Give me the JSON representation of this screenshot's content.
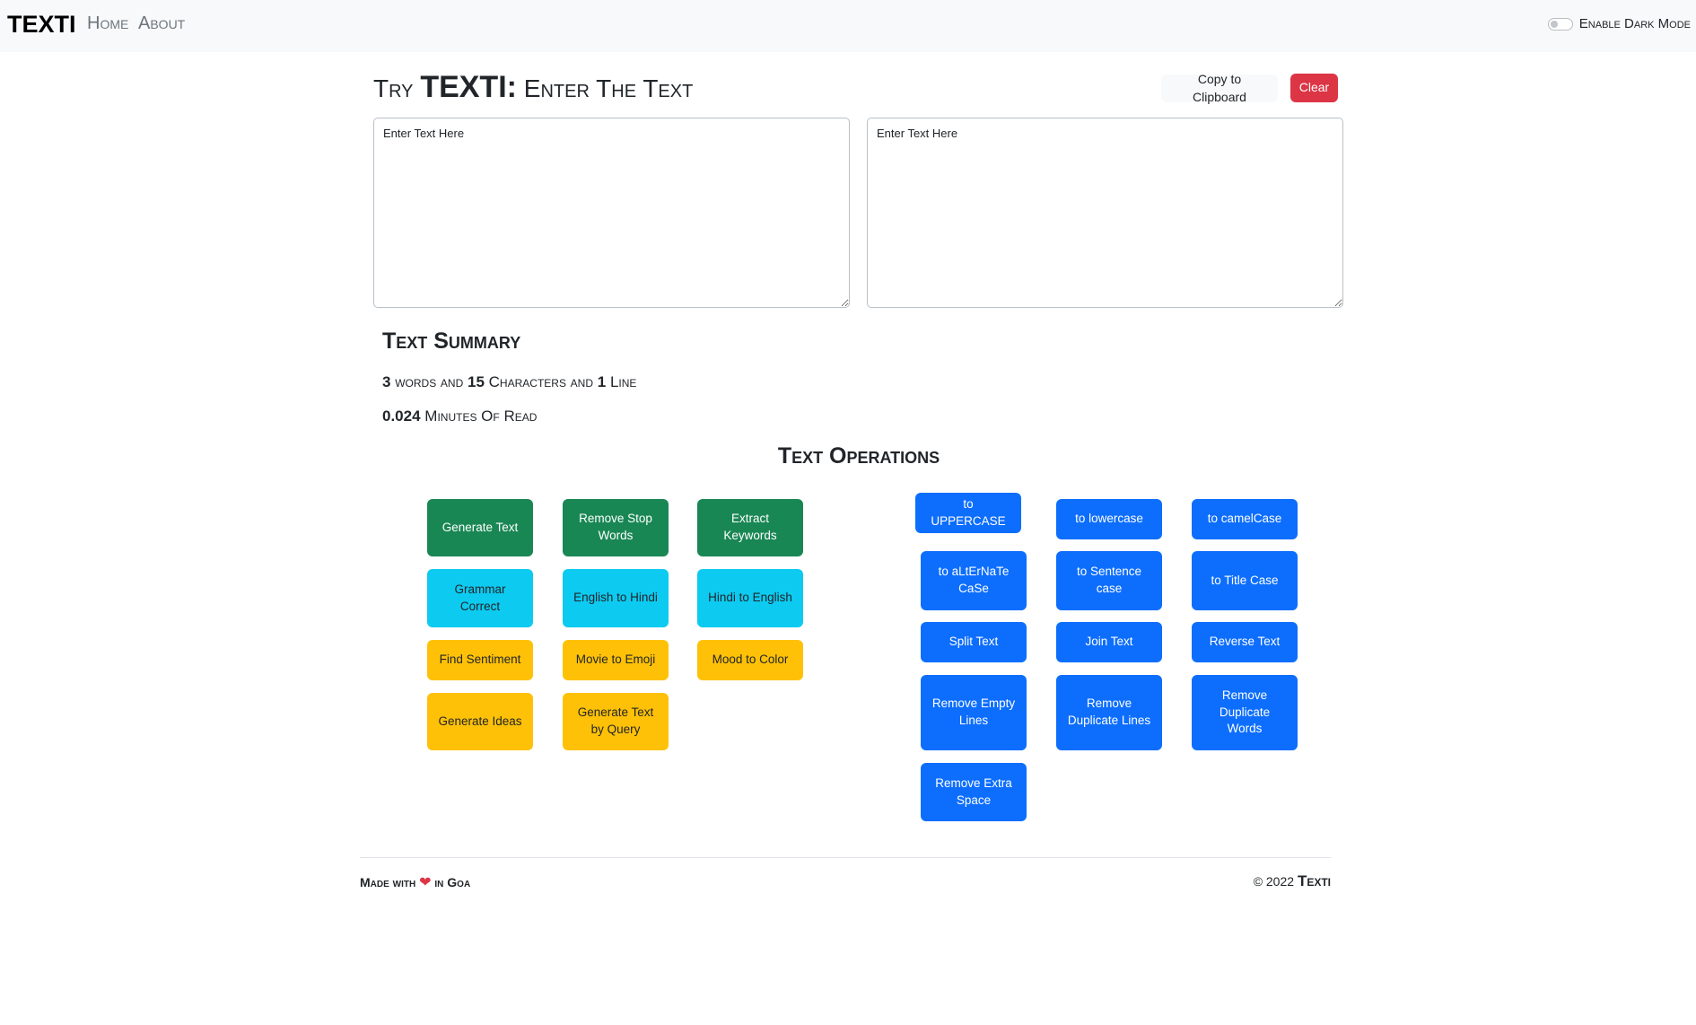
{
  "nav": {
    "brand": "TEXTI",
    "links": [
      "Home",
      "About"
    ],
    "dark_mode_label": "Enable Dark Mode"
  },
  "header": {
    "prefix": "Try",
    "brand": "TEXTI:",
    "suffix": "Enter The Text",
    "copy_label": "Copy to Clipboard",
    "clear_label": "Clear"
  },
  "inputs": {
    "left_placeholder": "Enter Text Here",
    "right_placeholder": "Enter Text Here"
  },
  "summary": {
    "title": "Text Summary",
    "words": "3",
    "words_label": "words and",
    "chars": "15",
    "chars_label": "Characters and",
    "lines": "1",
    "lines_label": "Line",
    "minutes": "0.024",
    "minutes_label": "Minutes Of Read"
  },
  "operations": {
    "title": "Text Operations",
    "ai": [
      "Generate Text",
      "Remove Stop Words",
      "Extract Keywords",
      "Grammar Correct",
      "English to Hindi",
      "Hindi to English",
      "Find Sentiment",
      "Movie to Emoji",
      "Mood to Color",
      "Generate Ideas",
      "Generate Text by Query"
    ],
    "transform": [
      "to UPPERCASE",
      "to lowercase",
      "to camelCase",
      "to aLtErNaTe CaSe",
      "to Sentence case",
      "to Title Case",
      "Split Text",
      "Join Text",
      "Reverse Text",
      "Remove Empty Lines",
      "Remove Duplicate Lines",
      "Remove Duplicate Words",
      "Remove Extra Space"
    ]
  },
  "footer": {
    "left_prefix": "Made with",
    "heart": "❤",
    "left_suffix": "in Goa",
    "copyright": "© 2022",
    "brand": "Texti"
  },
  "colors": {
    "green": "#198754",
    "cyan": "#0dcaf0",
    "yellow": "#ffc107",
    "blue": "#0d6efd",
    "red": "#dc3545"
  }
}
